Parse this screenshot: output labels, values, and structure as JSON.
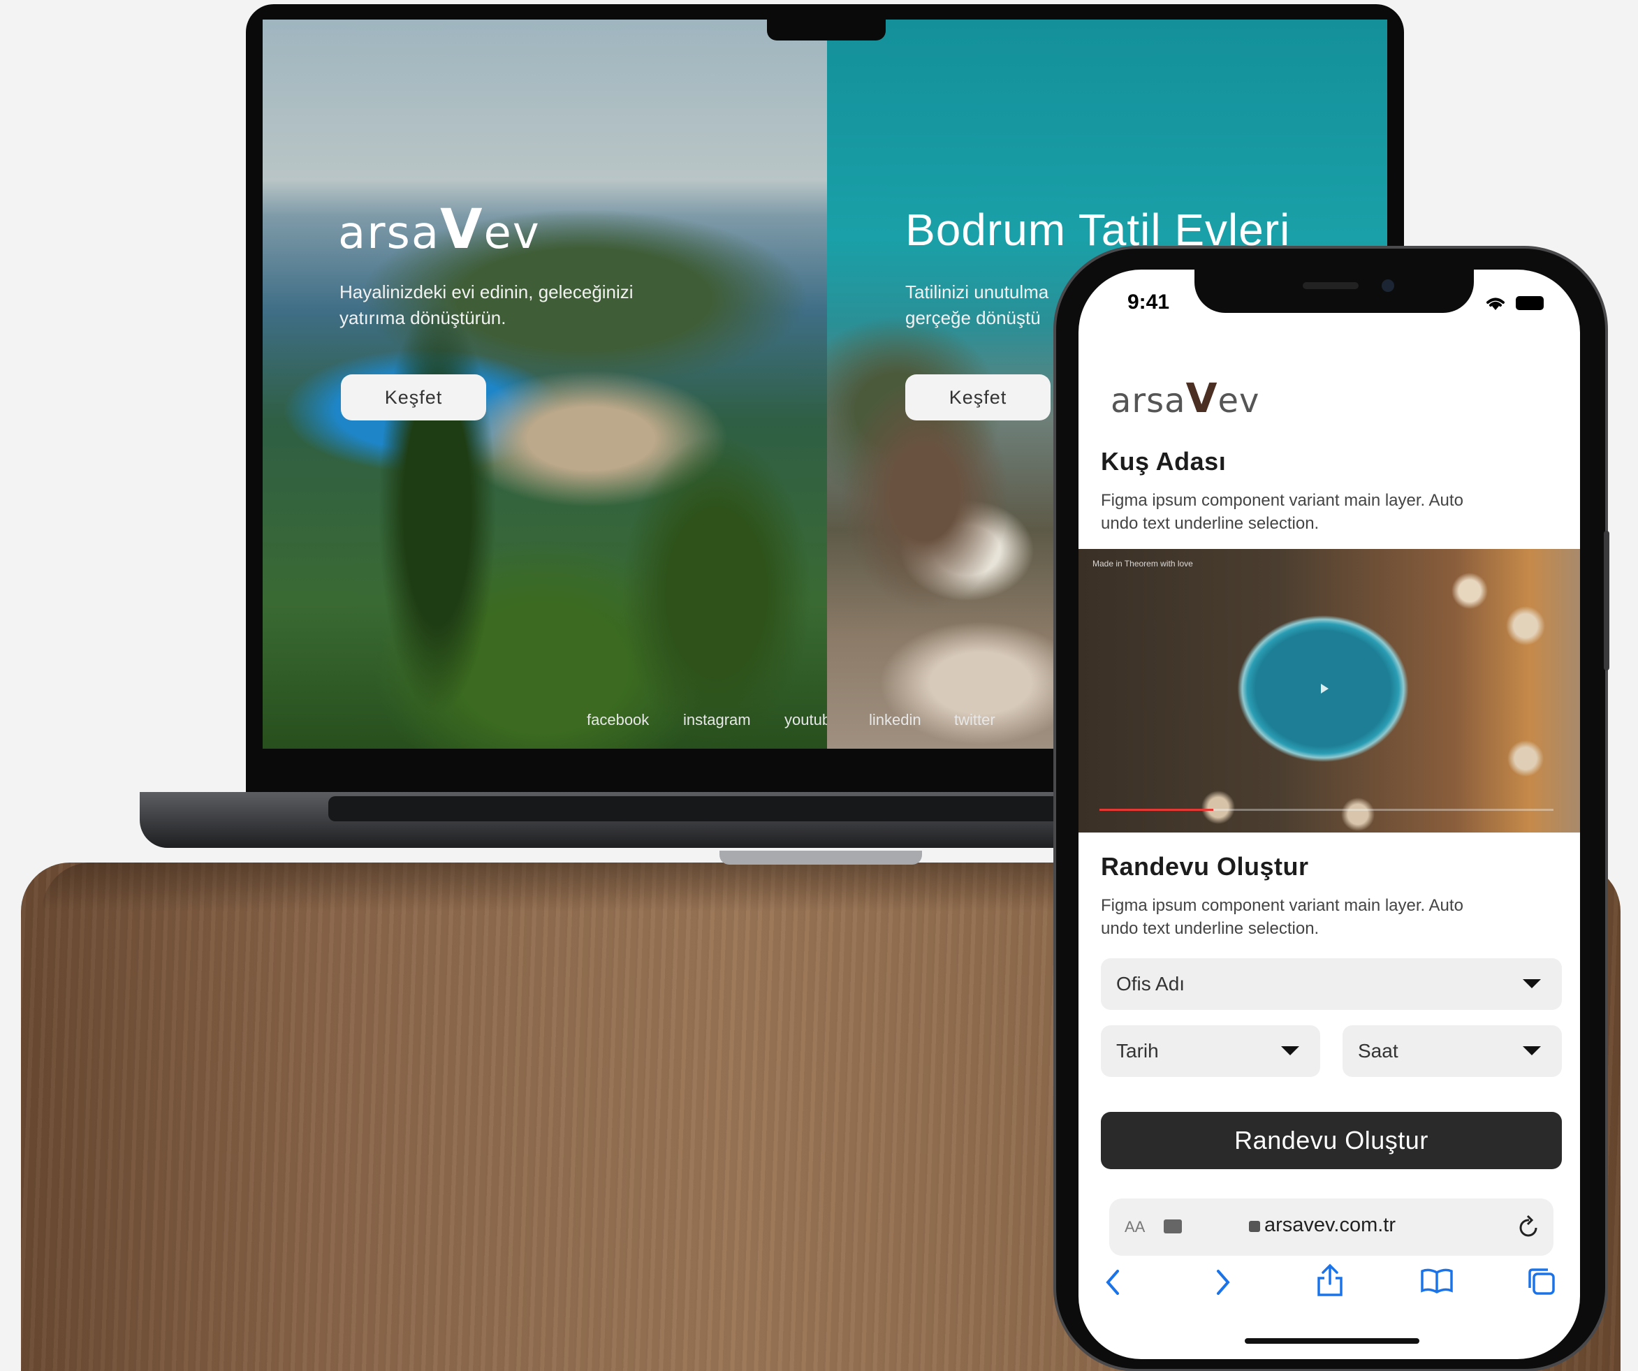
{
  "laptop": {
    "left": {
      "logo_pre": "arsa",
      "logo_mark": "V",
      "logo_post": "ev",
      "tagline_line1": "Hayalinizdeki evi edinin, geleceğinizi",
      "tagline_line2": "yatırıma dönüştürün.",
      "button": "Keşfet"
    },
    "right": {
      "heading": "Bodrum Tatil Evleri",
      "tagline_line1": "Tatilinizi unutulma",
      "tagline_line2": "gerçeğe dönüştü",
      "button": "Keşfet"
    },
    "social": [
      "facebook",
      "instagram",
      "youtube",
      "linkedin",
      "twitter"
    ]
  },
  "phone": {
    "status": {
      "time": "9:41",
      "icons": [
        "wifi-icon",
        "battery-icon"
      ]
    },
    "logo_pre": "arsa",
    "logo_mark": "V",
    "logo_post": "ev",
    "section1": {
      "title": "Kuş Adası",
      "text_line1": "Figma ipsum component variant main layer. Auto",
      "text_line2": "undo text underline selection."
    },
    "video": {
      "label": "Made in Theorem with love",
      "progress": 0.25
    },
    "section2": {
      "title": "Randevu Oluştur",
      "text_line1": "Figma ipsum component variant main layer. Auto",
      "text_line2": "undo text underline selection."
    },
    "form": {
      "office": "Ofis Adı",
      "date": "Tarih",
      "time": "Saat",
      "submit": "Randevu Oluştur"
    },
    "browser": {
      "aa": "AA",
      "url": "arsavev.com.tr",
      "toolbar": [
        "back-icon",
        "forward-icon",
        "share-icon",
        "bookmarks-icon",
        "tabs-icon"
      ]
    }
  },
  "colors": {
    "accent": "#1a73e8",
    "cta": "#2a2a2a",
    "logo_mark": "#4a2f22"
  }
}
